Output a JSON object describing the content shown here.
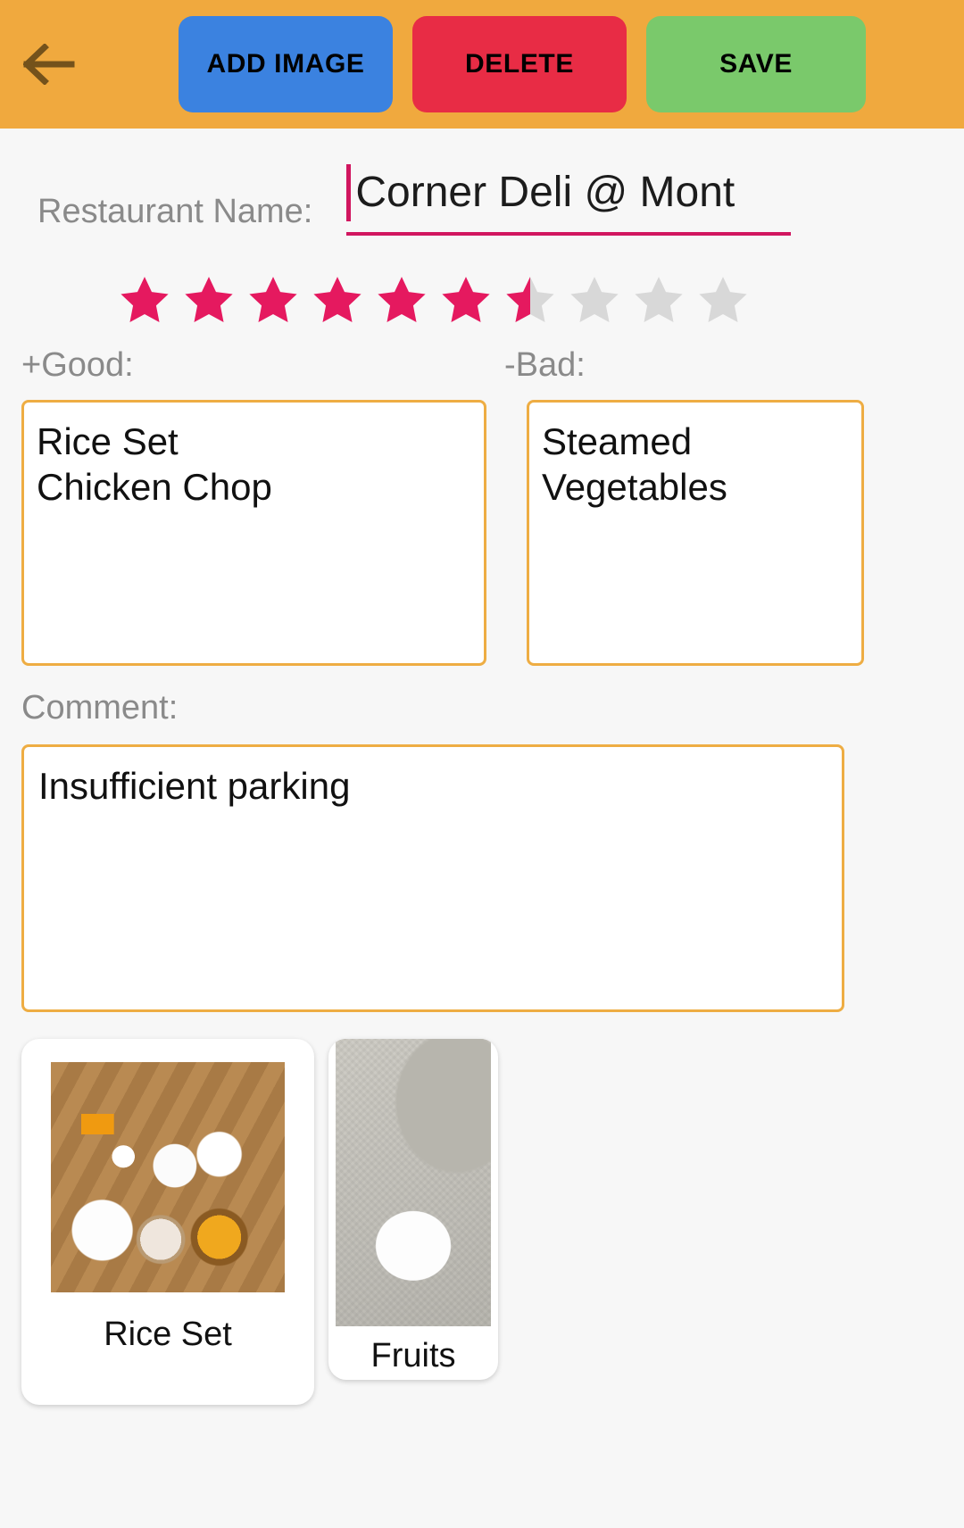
{
  "appbar": {
    "background_color": "#f0a93e",
    "back_icon": "arrow-left-icon",
    "buttons": [
      {
        "label": "ADD IMAGE",
        "color": "#3b82e0",
        "name": "add-image-button"
      },
      {
        "label": "DELETE",
        "color": "#e82c45",
        "name": "delete-button"
      },
      {
        "label": "SAVE",
        "color": "#7ac96b",
        "name": "save-button"
      }
    ]
  },
  "form": {
    "restaurant": {
      "label": "Restaurant Name:",
      "value": "Corner Deli @ Mont",
      "placeholder": "Restaurant Name",
      "underline_color": "#d1165f",
      "caret_visible": true
    },
    "rating": {
      "total_stars": 10,
      "filled_stars": 6,
      "half_star": true,
      "value": 6.5,
      "filled_color": "#e5195f",
      "empty_color": "#d8d8d8"
    },
    "good": {
      "label": "+Good:",
      "value": "Rice Set\nChicken Chop",
      "placeholder": ""
    },
    "bad": {
      "label": "-Bad:",
      "value": "Steamed\nVegetables",
      "placeholder": ""
    },
    "comment": {
      "label": "Comment:",
      "value": "Insufficient parking",
      "placeholder": ""
    },
    "field_border_color": "#eead43"
  },
  "gallery": {
    "cards": [
      {
        "caption": "Rice Set",
        "photo": "rice-set-photo"
      },
      {
        "caption": "Fruits",
        "photo": "fruits-photo"
      }
    ]
  }
}
